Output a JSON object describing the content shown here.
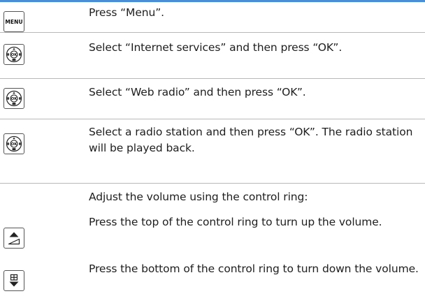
{
  "colors": {
    "accent": "#4a8fd6",
    "divider": "#b8b8b8"
  },
  "steps": [
    {
      "icon": "menu-key",
      "key_label": "MENU",
      "text": "Press “Menu”."
    },
    {
      "icon": "navigation-ok-key",
      "key_label": "OK",
      "text": "Select “Internet services” and then press “OK”."
    },
    {
      "icon": "navigation-ok-key",
      "key_label": "OK",
      "text": "Select “Web radio” and then press “OK”."
    },
    {
      "icon": "navigation-ok-key",
      "key_label": "OK",
      "text": "Select a radio station and then press “OK”. The radio station will be played back."
    }
  ],
  "volume": {
    "intro": "Adjust the volume using the control ring:",
    "items": [
      {
        "icon": "volume-up-key",
        "text": "Press the top of the control ring to turn up the volume."
      },
      {
        "icon": "volume-down-key",
        "text": "Press the bottom of the control ring to turn down the volume."
      }
    ]
  }
}
